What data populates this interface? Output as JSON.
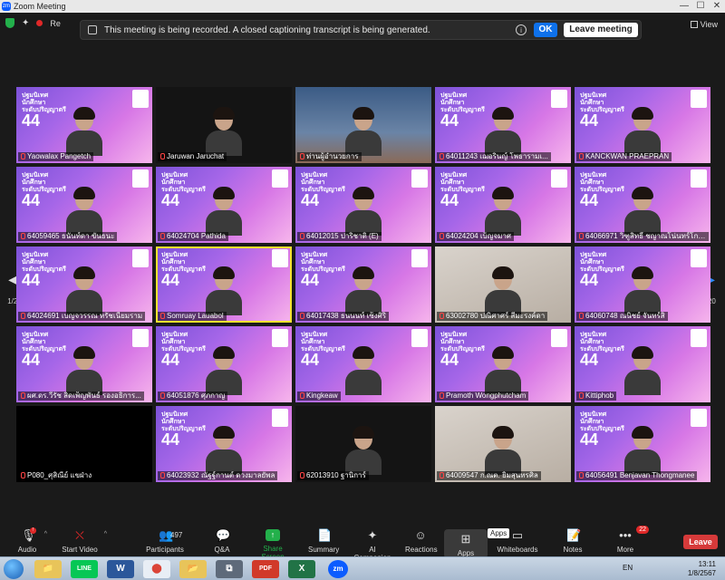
{
  "window": {
    "title": "Zoom Meeting",
    "app_icon": "zm"
  },
  "window_controls": {
    "minimize": "—",
    "maximize": "☐",
    "close": "✕"
  },
  "topbar": {
    "rec_label": "Re",
    "banner_text": "This meeting is being recorded. A closed captioning transcript is being generated.",
    "info_glyph": "i",
    "ok_label": "OK",
    "leave_meeting_label": "Leave meeting",
    "view_label": "View"
  },
  "promo": {
    "line1": "ปฐมนิเทศ",
    "line2": "นักศึกษา",
    "line3": "ระดับปริญญาตรี",
    "number": "44"
  },
  "participants": [
    {
      "name": "Yaowalax Pangetch",
      "style": "promo"
    },
    {
      "name": "Jaruwan Jaruchat",
      "style": "dark"
    },
    {
      "name": "ท่านผู้อำนวยการ",
      "style": "office"
    },
    {
      "name": "64011243 เฌอรินญ์ โพธารามเ...",
      "style": "promo"
    },
    {
      "name": "KANCKWAN PRAEPRAN",
      "style": "promo"
    },
    {
      "name": "64059465 ธนันท์ดา ขันธนะ",
      "style": "promo"
    },
    {
      "name": "64024704 Pathida",
      "style": "promo"
    },
    {
      "name": "64012015 ปาริชาติ (E)",
      "style": "promo"
    },
    {
      "name": "64024204 เบ็ญจมาศ",
      "style": "promo"
    },
    {
      "name": "64066971 วิฑูสิทธิ์ ชญาณโน่นทร์โกศิน",
      "style": "promo"
    },
    {
      "name": "64024691 เบญจวรรณ หรัชเนียมราม",
      "style": "promo"
    },
    {
      "name": "Somruay Lauabol",
      "style": "promo",
      "active": true
    },
    {
      "name": "64017438 ธนนนท์ เซ็งศิริ",
      "style": "promo"
    },
    {
      "name": "63002780 ปณิศาศร์ สีมะรงค์ดา",
      "style": "photo"
    },
    {
      "name": "64060748 ณนิชย์ จันทร์สิ",
      "style": "promo"
    },
    {
      "name": "ผศ.ดร.วีรัช สิดเพ็ญพันธ์ รองอธิการ...",
      "style": "promo"
    },
    {
      "name": "64051876 ศุภกาญ",
      "style": "promo"
    },
    {
      "name": "Kingkeaw",
      "style": "promo"
    },
    {
      "name": "Pramoth Wongphutcham",
      "style": "promo"
    },
    {
      "name": "Kittiphob",
      "style": "promo"
    },
    {
      "name": "P080_ศุสิณีย์ แขฝ่าง",
      "style": "black"
    },
    {
      "name": "64023932 ณัฐฐ์กานต์ ดวงมาลยัพล",
      "style": "promo"
    },
    {
      "name": "62013910 ฐานิการ์",
      "style": "dark"
    },
    {
      "name": "64009547 ก.ณต. ยิ้มสุนทรศิล",
      "style": "photo"
    },
    {
      "name": "64056491 Benjavan Thongmanee",
      "style": "promo"
    }
  ],
  "pager": {
    "left_arrow": "◀",
    "right_arrow": "▶",
    "left_count": "1/20",
    "right_count": "1/20"
  },
  "toolbar": {
    "audio": "Audio",
    "start_video": "Start Video",
    "participants": "Participants",
    "participants_count": "497",
    "qa": "Q&A",
    "share_screen": "Share Screen",
    "summary": "Summary",
    "ai_companion": "AI Companion",
    "reactions": "Reactions",
    "apps": "Apps",
    "apps_tooltip": "Apps",
    "whiteboards": "Whiteboards",
    "notes": "Notes",
    "more": "More",
    "more_badge": "22",
    "leave": "Leave",
    "audio_badge": "!"
  },
  "taskbar": {
    "icons": [
      "📁",
      "LINE",
      "W",
      "⬤",
      "📂",
      "⧉",
      "PDF",
      "X",
      "zm"
    ],
    "lang": "EN",
    "time": "13:11",
    "date": "1/8/2567"
  },
  "colors": {
    "zoom_blue": "#0e71eb",
    "share_green": "#23b04b",
    "leave_red": "#d63a3a",
    "active_speaker": "#f4e22e"
  }
}
